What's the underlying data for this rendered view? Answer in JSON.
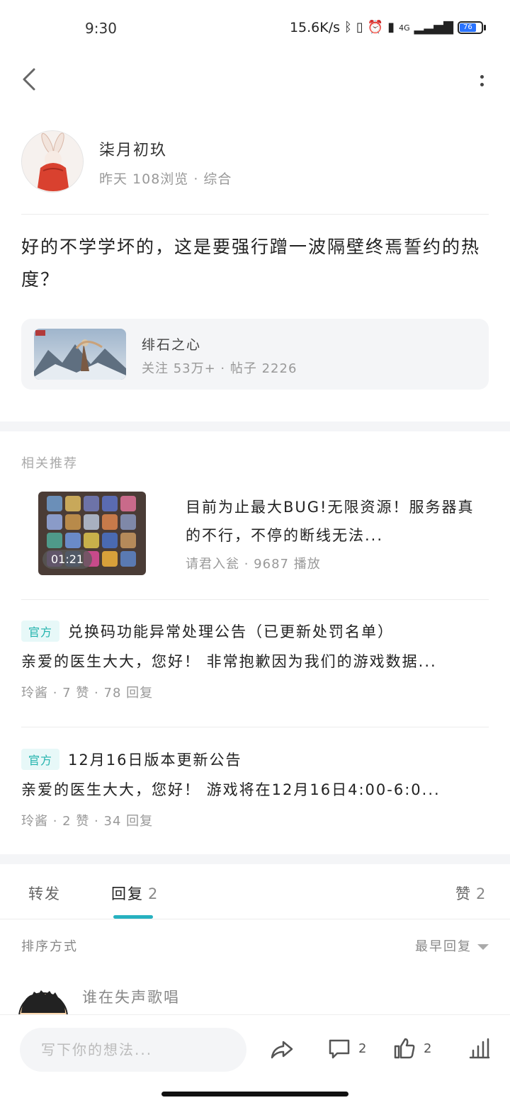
{
  "status_bar": {
    "time": "9:30",
    "network_speed": "15.6K/s",
    "network_type": "4G",
    "battery_level": "76"
  },
  "post": {
    "author_name": "柒月初玖",
    "meta": "昨天  108浏览 · 综合",
    "text": "好的不学学坏的，这是要强行蹭一波隔壁终焉誓约的热度？"
  },
  "game_card": {
    "name": "绯石之心",
    "stats": "关注  53万+ · 帖子  2226"
  },
  "related": {
    "section_title": "相关推荐",
    "video": {
      "duration": "01:21",
      "title": "目前为止最大BUG!无限资源！服务器真的不行，不停的断线无法...",
      "meta": "请君入瓮 · 9687 播放"
    },
    "notices": [
      {
        "tag": "官方",
        "title": "兑换码功能异常处理公告（已更新处罚名单）",
        "excerpt": "亲爱的医生大大，您好！ 非常抱歉因为我们的游戏数据...",
        "meta": "玲酱 · 7 赞 · 78 回复"
      },
      {
        "tag": "官方",
        "title": "12月16日版本更新公告",
        "excerpt": "亲爱的医生大大，您好！        游戏将在12月16日4:00-6:0...",
        "meta": "玲酱 · 2 赞 · 34 回复"
      }
    ]
  },
  "tabs": {
    "forward": "转发",
    "reply": "回复",
    "reply_count": "2",
    "like": "赞",
    "like_count": "2"
  },
  "sort": {
    "label": "排序方式",
    "value": "最早回复"
  },
  "reply": {
    "name": "谁在失声歌唱"
  },
  "bottom_bar": {
    "input_placeholder": "写下你的想法...",
    "comment_count": "2",
    "like_count": "2"
  },
  "colors": {
    "accent": "#26b1c0",
    "official_tag_bg": "#e7f8f8",
    "official_tag_text": "#22b3ad",
    "section_bg": "#f4f5f7"
  }
}
